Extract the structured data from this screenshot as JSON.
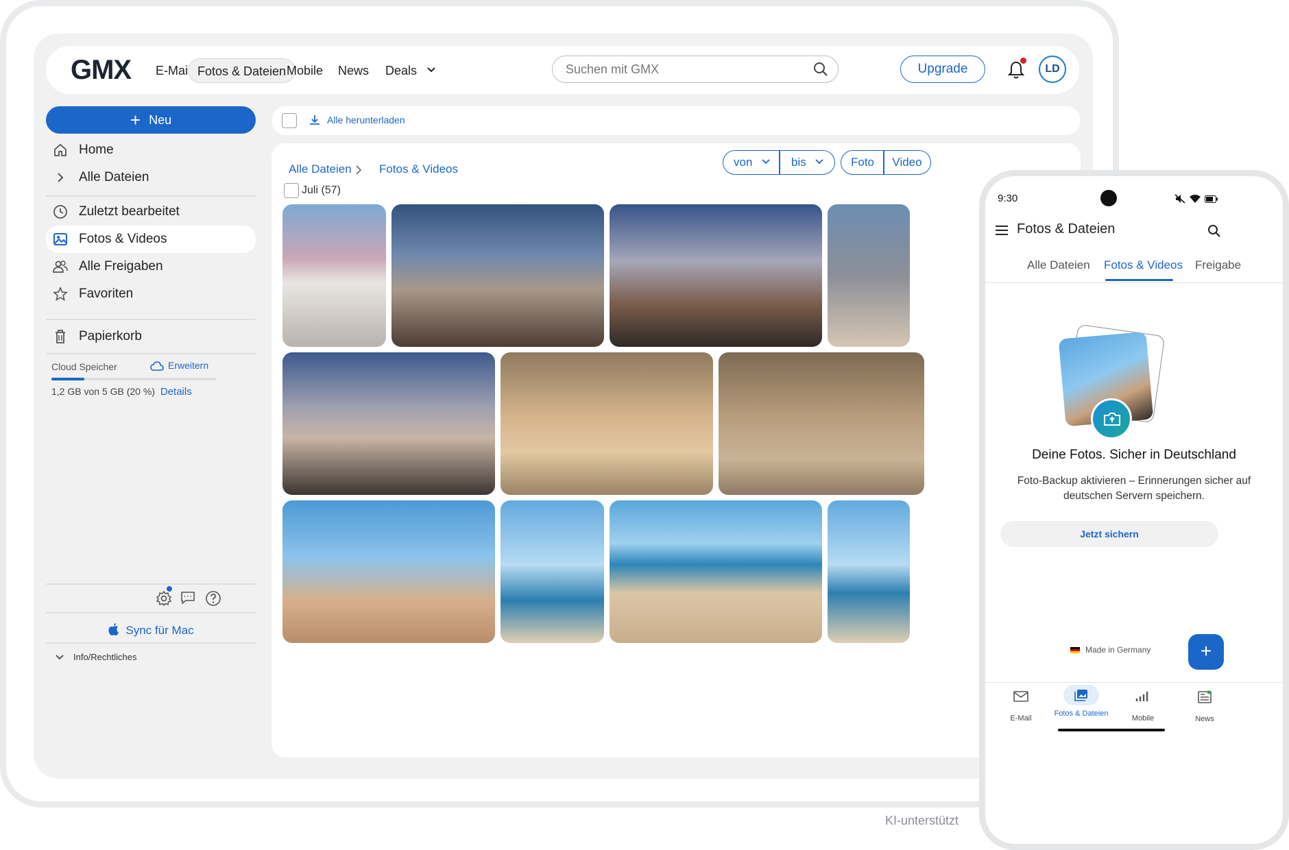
{
  "tablet": {
    "topbar": {
      "logo": "GMX",
      "nav": [
        "E-Mail",
        "Fotos & Dateien",
        "Mobile",
        "News",
        "Deals"
      ],
      "search_placeholder": "Suchen mit GMX",
      "upgrade": "Upgrade",
      "avatar_initials": "LD"
    },
    "sidebar": {
      "new_button": "Neu",
      "items": [
        "Home",
        "Alle Dateien",
        "Zuletzt bearbeitet",
        "Fotos & Videos",
        "Alle Freigaben",
        "Favoriten",
        "Papierkorb"
      ],
      "storage_label": "Cloud Speicher",
      "expand_label": "Erweitern",
      "usage_text": "1,2 GB von 5 GB (20 %)",
      "usage_fraction": 0.2,
      "details_link": "Details",
      "sync_label": "Sync für Mac",
      "legal_label": "Info/Rechtliches"
    },
    "toolbar": {
      "download_all": "Alle herunterladen"
    },
    "breadcrumb": [
      "Alle Dateien",
      "Fotos & Videos"
    ],
    "filters": {
      "from": "von",
      "to": "bis",
      "photo": "Foto",
      "video": "Video"
    },
    "group_label": "Juli (57)"
  },
  "phone": {
    "time": "9:30",
    "title": "Fotos & Dateien",
    "tabs": [
      "Alle Dateien",
      "Fotos & Videos",
      "Freigabe"
    ],
    "headline": "Deine Fotos. Sicher in Deutschland",
    "body": "Foto-Backup aktivieren – Erinnerungen sicher auf deutschen Servern speichern.",
    "cta": "Jetzt sichern",
    "made_in": "Made in Germany",
    "bottom_nav": [
      "E-Mail",
      "Fotos & Dateien",
      "Mobile",
      "News"
    ]
  },
  "footnote": "KI-unterstützt",
  "colors": {
    "accent": "#1b67c9",
    "notification": "#d9202c"
  }
}
